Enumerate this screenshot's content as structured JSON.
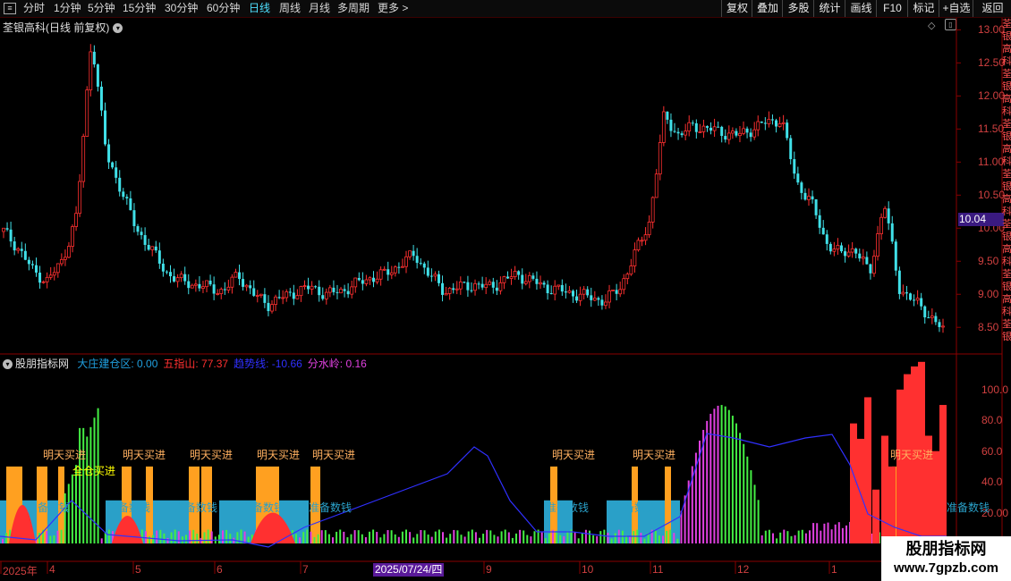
{
  "toolbar": {
    "left": [
      {
        "label": "分时",
        "active": false
      },
      {
        "label": "1分钟",
        "active": false
      },
      {
        "label": "5分钟",
        "active": false
      },
      {
        "label": "15分钟",
        "active": false
      },
      {
        "label": "30分钟",
        "active": false
      },
      {
        "label": "60分钟",
        "active": false
      },
      {
        "label": "日线",
        "active": true
      },
      {
        "label": "周线",
        "active": false
      },
      {
        "label": "月线",
        "active": false
      },
      {
        "label": "多周期",
        "active": false
      },
      {
        "label": "更多 >",
        "active": false
      }
    ],
    "right": [
      "复权",
      "叠加",
      "多股",
      "统计",
      "画线",
      "F10",
      "标记",
      "+自选",
      "返回"
    ]
  },
  "main_panel": {
    "title": "荃银高科(日线 前复权)",
    "current_price_tag": "10.04",
    "price_axis": [
      "13.00",
      "12.50",
      "12.00",
      "11.50",
      "11.00",
      "10.50",
      "10.00",
      "9.50",
      "9.00",
      "8.50"
    ]
  },
  "indicator_panel": {
    "name": "股朋指标网",
    "items": [
      {
        "label": "大庄建仓区:",
        "value": "0.00",
        "color": "#20a0e0"
      },
      {
        "label": "五指山:",
        "value": "77.37",
        "color": "#ff3030"
      },
      {
        "label": "趋势线:",
        "value": "-10.66",
        "color": "#3030ff"
      },
      {
        "label": "分水岭:",
        "value": "0.16",
        "color": "#e040e0"
      }
    ],
    "axis": [
      "100.0",
      "80.0",
      "60.0",
      "40.0",
      "20.00"
    ],
    "signals": [
      "明天买进",
      "明天买进",
      "明天买进",
      "明天买进",
      "明天买进",
      "明天买进",
      "明天买进",
      "明天买进"
    ],
    "full_position": "全仓买进",
    "zone_label": "准备数钱"
  },
  "date_axis": {
    "labels": [
      "2025年",
      "4",
      "5",
      "6",
      "7",
      "9",
      "10",
      "11",
      "12",
      "1"
    ],
    "highlight": "2025/07/24/四"
  },
  "right_strip": [
    "荃",
    "银",
    "高",
    "科",
    "荃",
    "银",
    "高",
    "科",
    "荃",
    "银",
    "高",
    "科",
    "荃",
    "银",
    "高",
    "科",
    "荃",
    "银",
    "高",
    "科",
    "荃",
    "银",
    "高",
    "科",
    "荃",
    "银"
  ],
  "watermark": {
    "line1": "股朋指标网",
    "line2": "www.7gpzb.com"
  },
  "colors": {
    "up": "#ff3030",
    "down": "#40e0e8",
    "ma": "#3030ff",
    "green": "#44ee44",
    "magenta": "#e040e0",
    "zone": "#2aa0c8",
    "orange": "#ffa020",
    "bg": "#000000",
    "border": "#8a0000"
  },
  "chart_data": [
    {
      "type": "candlestick",
      "title": "荃银高科(日线 前复权)",
      "ylim": [
        8.3,
        13.1
      ],
      "sampled_closes": [
        9.95,
        9.7,
        9.35,
        9.2,
        9.5,
        10.2,
        12.9,
        11.1,
        10.6,
        10.0,
        9.7,
        9.35,
        9.2,
        9.15,
        9.1,
        9.05,
        9.3,
        9.0,
        8.85,
        8.95,
        9.05,
        9.1,
        9.0,
        9.05,
        9.15,
        9.25,
        9.3,
        9.45,
        9.6,
        9.3,
        9.05,
        9.1,
        9.15,
        9.1,
        9.2,
        9.3,
        9.2,
        9.1,
        9.05,
        9.0,
        8.95,
        8.9,
        9.1,
        9.6,
        10.1,
        11.7,
        11.4,
        11.55,
        11.5,
        11.45,
        11.4,
        11.5,
        11.6,
        11.65,
        10.7,
        10.4,
        9.8,
        9.6,
        9.7,
        9.3,
        10.4,
        9.1,
        8.9,
        8.7,
        8.45
      ]
    },
    {
      "type": "bar",
      "title": "股朋指标网",
      "ylim": [
        0,
        115
      ],
      "series": [
        {
          "name": "大庄建仓区",
          "values": [
            0,
            18,
            0,
            18,
            0,
            0,
            0,
            0,
            0,
            18,
            0,
            0,
            18,
            0,
            0,
            0
          ]
        },
        {
          "name": "五指山",
          "values": [
            77.37
          ]
        },
        {
          "name": "趋势线",
          "values": [
            -10.66
          ]
        },
        {
          "name": "分水岭",
          "values": [
            0.16
          ]
        }
      ]
    }
  ]
}
